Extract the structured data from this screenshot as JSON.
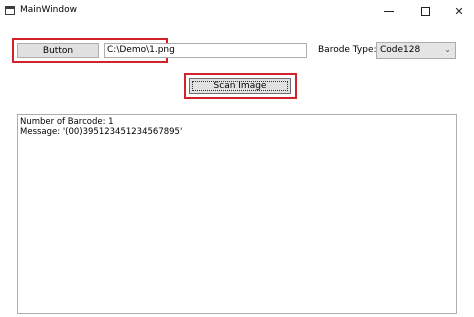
{
  "window": {
    "title": "MainWindow",
    "controls": {
      "minimize": "—",
      "maximize": "☐",
      "close": "✕"
    }
  },
  "toolbar": {
    "browse_label": "Button",
    "file_path": "C:\\Demo\\1.png",
    "barcode_type_label": "Barode Type:",
    "barcode_type_value": "Code128",
    "dropdown_icon": "chevron-down-icon"
  },
  "actions": {
    "scan_label": "Scan Image"
  },
  "results": {
    "lines": [
      "Number of Barcode: 1",
      "Message: '(00)395123451234567895'"
    ]
  },
  "colors": {
    "highlight": "#d2232a",
    "button_bg": "#e1e1e1"
  }
}
